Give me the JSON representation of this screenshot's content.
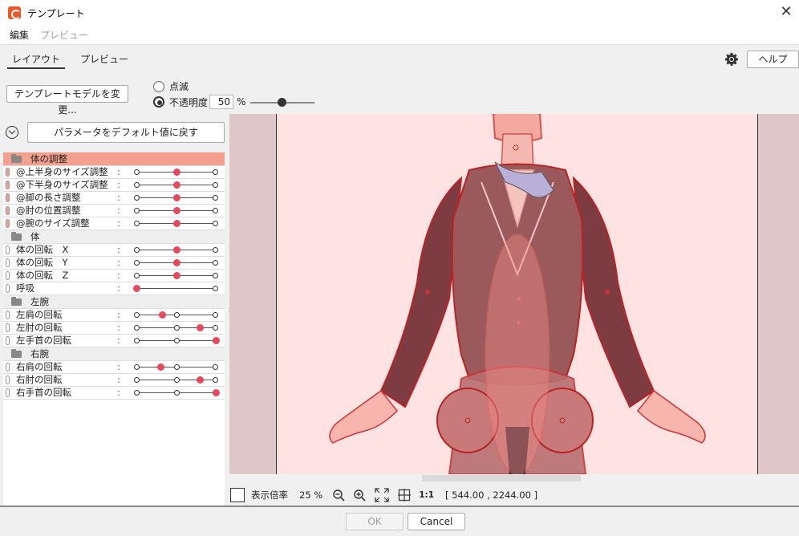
{
  "window": {
    "title": "テンプレート",
    "close_glyph": "✕"
  },
  "menu": {
    "items": [
      {
        "label": "編集",
        "enabled": true
      },
      {
        "label": "プレビュー",
        "enabled": false
      }
    ]
  },
  "tabs": [
    {
      "label": "レイアウト",
      "active": true
    },
    {
      "label": "プレビュー",
      "active": false
    }
  ],
  "toolbar": {
    "help_label": "ヘルプ"
  },
  "model": {
    "change_label": "テンプレートモデルを変更...",
    "blink_label": "点滅",
    "opacity_label": "不透明度",
    "opacity_value": "50",
    "opacity_unit": "%",
    "opacity_fraction": 0.5
  },
  "params": {
    "reset_label": "パラメータをデフォルト値に戻す",
    "groups": [
      {
        "name": "体の調整",
        "selected": true,
        "items": [
          {
            "label": "@上半身のサイズ調整",
            "value": 0.5,
            "mid": false,
            "pin": "red"
          },
          {
            "label": "@下半身のサイズ調整",
            "value": 0.5,
            "mid": false,
            "pin": "red"
          },
          {
            "label": "@脚の長さ調整",
            "value": 0.5,
            "mid": false,
            "pin": "red"
          },
          {
            "label": "@肘の位置調整",
            "value": 0.5,
            "mid": false,
            "pin": "red"
          },
          {
            "label": "@腕のサイズ調整",
            "value": 0.5,
            "mid": false,
            "pin": "red"
          }
        ]
      },
      {
        "name": "体",
        "selected": false,
        "items": [
          {
            "label": "体の回転　X",
            "value": 0.5,
            "mid": false,
            "pin": "gray"
          },
          {
            "label": "体の回転　Y",
            "value": 0.5,
            "mid": false,
            "pin": "gray"
          },
          {
            "label": "体の回転　Z",
            "value": 0.5,
            "mid": false,
            "pin": "gray"
          },
          {
            "label": "呼吸",
            "value": 0.0,
            "mid": false,
            "pin": "gray"
          }
        ]
      },
      {
        "name": "左腕",
        "selected": false,
        "items": [
          {
            "label": "左肩の回転",
            "value": 0.32,
            "mid": true,
            "pin": "gray"
          },
          {
            "label": "左肘の回転",
            "value": 0.8,
            "mid": true,
            "pin": "gray"
          },
          {
            "label": "左手首の回転",
            "value": 1.0,
            "mid": true,
            "pin": "gray"
          }
        ]
      },
      {
        "name": "右腕",
        "selected": false,
        "items": [
          {
            "label": "右肩の回転",
            "value": 0.3,
            "mid": true,
            "pin": "gray"
          },
          {
            "label": "右肘の回転",
            "value": 0.8,
            "mid": true,
            "pin": "gray"
          },
          {
            "label": "右手首の回転",
            "value": 1.0,
            "mid": true,
            "pin": "gray"
          }
        ]
      }
    ]
  },
  "status": {
    "zoom_label": "表示倍率",
    "zoom_value": "25 %",
    "one_to_one": "1:1",
    "coords": "[ 544.00 , 2244.00 ]"
  },
  "footer": {
    "ok_label": "OK",
    "cancel_label": "Cancel"
  }
}
